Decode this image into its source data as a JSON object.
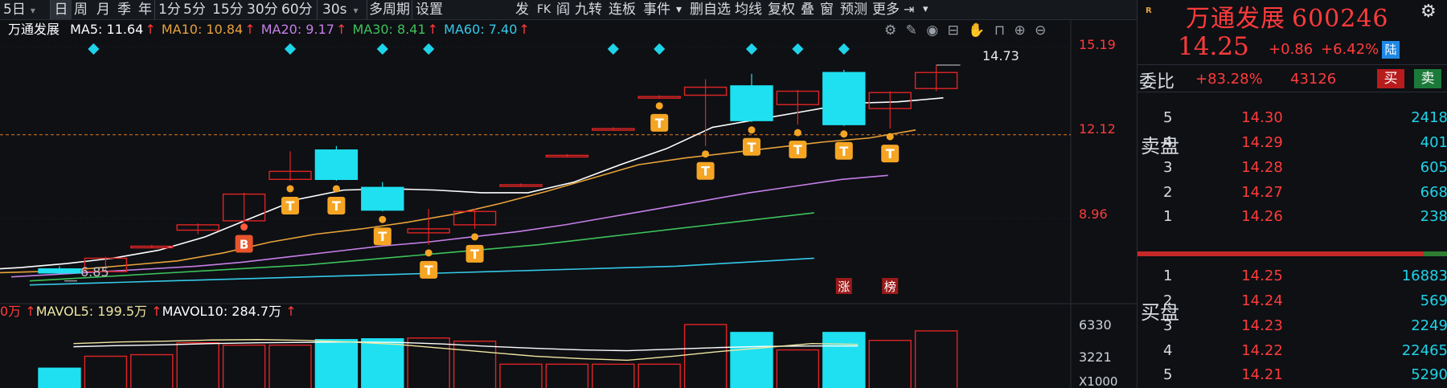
{
  "toolbar": {
    "period_dropdown": "5日",
    "periods": [
      "日",
      "周",
      "月",
      "季",
      "年",
      "1分",
      "5分",
      "15分",
      "30分",
      "60分"
    ],
    "period_dropdown2": "30s",
    "multi_period": "多周期",
    "settings": "设置",
    "right_items": [
      "发",
      "FK",
      "阎",
      "九转",
      "连板",
      "事件",
      "▾",
      "删自选",
      "均线",
      "复权",
      "叠",
      "窗",
      "预测",
      "更多"
    ]
  },
  "ma": {
    "name": "万通发展",
    "ma5": "MA5: 11.64",
    "ma10": "MA10: 10.84",
    "ma20": "MA20: 9.17",
    "ma30": "MA30: 8.41",
    "ma60": "MA60: 7.40",
    "arrow": "↑"
  },
  "price_axis": {
    "top": "15.19",
    "mid": "12.12",
    "low": "8.96"
  },
  "annotations": {
    "high": "14.73",
    "low": "6.85",
    "limit_up": "涨",
    "ranking": "榜",
    "buy": "B",
    "trade": "T"
  },
  "volume": {
    "prefix": "0万",
    "mavol5": "MAVOL5: 199.5万",
    "mavol10": "MAVOL10: 284.7万",
    "arrow": "↑",
    "axis_top": "6330",
    "axis_mid": "3221",
    "axis_unit": "X1000"
  },
  "chart_data": {
    "type": "candlestick",
    "ylim": [
      5.8,
      15.6
    ],
    "reference_line": 12.12,
    "candles": [
      {
        "open": 7.1,
        "close": 6.95,
        "high": 7.2,
        "low": 6.9,
        "color": "cyan"
      },
      {
        "open": 7.0,
        "close": 7.5,
        "high": 7.55,
        "low": 6.95,
        "color": "red"
      },
      {
        "open": 7.95,
        "close": 7.95,
        "high": 8.0,
        "low": 7.9,
        "color": "red"
      },
      {
        "open": 8.55,
        "close": 8.75,
        "high": 8.8,
        "low": 8.4,
        "color": "red"
      },
      {
        "open": 8.9,
        "close": 9.9,
        "high": 9.95,
        "low": 8.85,
        "color": "red"
      },
      {
        "open": 10.45,
        "close": 10.75,
        "high": 11.5,
        "low": 10.4,
        "color": "red"
      },
      {
        "open": 11.55,
        "close": 10.45,
        "high": 11.7,
        "low": 10.4,
        "color": "cyan"
      },
      {
        "open": 10.15,
        "close": 9.3,
        "high": 10.35,
        "low": 9.25,
        "color": "cyan"
      },
      {
        "open": 8.6,
        "close": 8.45,
        "high": 9.35,
        "low": 8.0,
        "color": "red"
      },
      {
        "open": 8.75,
        "close": 9.25,
        "high": 9.35,
        "low": 8.6,
        "color": "red"
      },
      {
        "open": 10.25,
        "close": 10.25,
        "high": 10.3,
        "low": 10.2,
        "color": "red"
      },
      {
        "open": 11.35,
        "close": 11.35,
        "high": 11.4,
        "low": 11.3,
        "color": "red"
      },
      {
        "open": 12.35,
        "close": 12.35,
        "high": 12.4,
        "low": 12.3,
        "color": "red"
      },
      {
        "open": 13.55,
        "close": 13.55,
        "high": 13.6,
        "low": 13.5,
        "color": "red"
      },
      {
        "open": 13.6,
        "close": 13.9,
        "high": 14.2,
        "low": 11.7,
        "color": "red"
      },
      {
        "open": 13.95,
        "close": 12.65,
        "high": 14.4,
        "low": 12.6,
        "color": "cyan"
      },
      {
        "open": 13.75,
        "close": 13.25,
        "high": 13.8,
        "low": 12.5,
        "color": "red"
      },
      {
        "open": 14.45,
        "close": 12.5,
        "high": 14.55,
        "low": 12.45,
        "color": "cyan"
      },
      {
        "open": 13.7,
        "close": 13.1,
        "high": 13.75,
        "low": 12.35,
        "color": "red"
      },
      {
        "open": 14.45,
        "close": 13.85,
        "high": 14.73,
        "low": 13.75,
        "color": "red"
      }
    ],
    "ma5": [
      7.05,
      7.15,
      7.3,
      7.5,
      7.8,
      8.3,
      9.0,
      9.7,
      10.05,
      10.1,
      10.05,
      9.95,
      9.95,
      10.35,
      11.0,
      11.6,
      12.4,
      12.7,
      13.0,
      13.3,
      13.35,
      13.5
    ],
    "ma10": [
      6.95,
      7.0,
      7.1,
      7.25,
      7.4,
      7.7,
      8.1,
      8.4,
      8.6,
      8.85,
      9.15,
      9.55,
      10.0,
      10.5,
      11.0,
      11.25,
      11.45,
      11.65,
      11.85,
      12.0,
      12.3
    ],
    "ma20": [
      6.8,
      6.9,
      7.0,
      7.1,
      7.2,
      7.35,
      7.55,
      7.75,
      7.95,
      8.1,
      8.3,
      8.5,
      8.75,
      9.05,
      9.35,
      9.65,
      9.95,
      10.2,
      10.45,
      10.6
    ],
    "ma30": [
      6.65,
      6.75,
      6.85,
      6.95,
      7.05,
      7.15,
      7.25,
      7.4,
      7.55,
      7.7,
      7.85,
      8.0,
      8.2,
      8.4,
      8.6,
      8.8,
      9.0,
      9.2
    ],
    "ma60": [
      6.5,
      6.55,
      6.6,
      6.65,
      6.7,
      6.75,
      6.8,
      6.85,
      6.9,
      6.95,
      7.0,
      7.05,
      7.1,
      7.15,
      7.2,
      7.3,
      7.4,
      7.5
    ],
    "volumes": [
      2.5,
      4.0,
      4.2,
      5.7,
      5.4,
      5.4,
      6.1,
      6.2,
      6.3,
      5.9,
      3.0,
      3.0,
      3.0,
      3.0,
      8.0,
      7.0,
      4.8,
      7.0,
      6.0,
      7.2
    ],
    "volume_colors": [
      "cyan",
      "red",
      "red",
      "red",
      "red",
      "red",
      "cyan",
      "cyan",
      "red",
      "red",
      "red",
      "red",
      "red",
      "red",
      "red",
      "cyan",
      "red",
      "cyan",
      "red",
      "red"
    ],
    "mavol5": [
      5.6,
      5.8,
      5.9,
      6.05,
      6.1,
      6.0,
      5.8,
      5.5,
      5.0,
      4.5,
      4.0,
      3.7,
      3.5,
      4.0,
      4.6,
      5.1,
      5.6,
      5.5
    ],
    "mavol10": [
      5.2,
      5.35,
      5.45,
      5.6,
      5.7,
      5.75,
      5.8,
      5.75,
      5.55,
      5.25,
      5.0,
      4.8,
      4.7,
      4.9,
      5.1,
      5.25,
      5.3,
      5.3
    ]
  },
  "stock": {
    "name": "万通发展",
    "code": "600246",
    "price": "14.25",
    "change": "+0.86",
    "change_pct": "+6.42%",
    "exchange_badge": "陆",
    "settings_icon": "gear-icon"
  },
  "order_book": {
    "weibi_label": "委比",
    "weibi_value": "+83.28%",
    "weibi_qty": "43126",
    "buy_label": "买",
    "sell_label": "卖",
    "asks_title": "卖盘",
    "bids_title": "买盘",
    "asks": [
      {
        "level": "5",
        "price": "14.30",
        "volume": "2418"
      },
      {
        "level": "4",
        "price": "14.29",
        "volume": "401"
      },
      {
        "level": "3",
        "price": "14.28",
        "volume": "605"
      },
      {
        "level": "2",
        "price": "14.27",
        "volume": "668"
      },
      {
        "level": "1",
        "price": "14.26",
        "volume": "238"
      }
    ],
    "bids": [
      {
        "level": "1",
        "price": "14.25",
        "volume": "16883"
      },
      {
        "level": "2",
        "price": "14.24",
        "volume": "569"
      },
      {
        "level": "3",
        "price": "14.23",
        "volume": "2249"
      },
      {
        "level": "4",
        "price": "14.22",
        "volume": "22465"
      },
      {
        "level": "5",
        "price": "14.21",
        "volume": "5290"
      }
    ]
  }
}
